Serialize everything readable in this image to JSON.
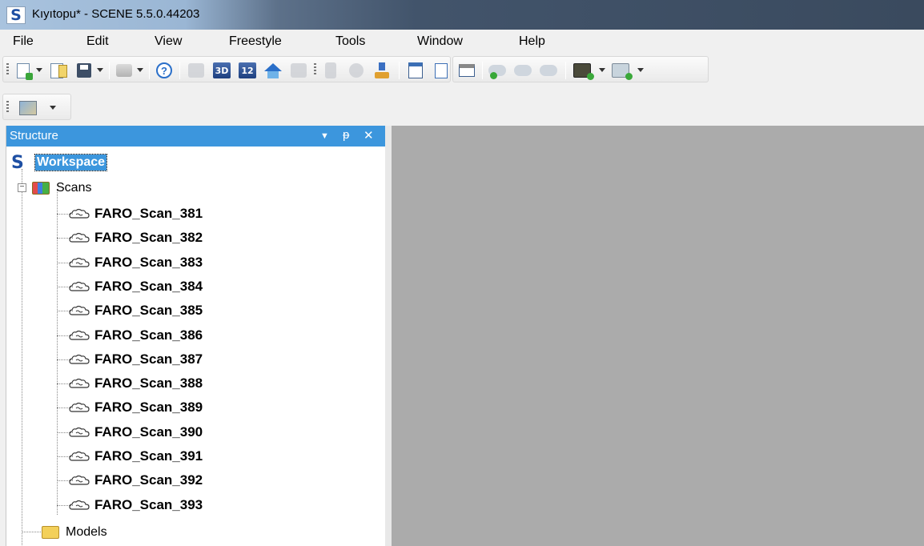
{
  "window": {
    "title": "Kıyıtopu* - SCENE 5.5.0.44203",
    "app_icon_glyph": "S"
  },
  "menu": [
    "File",
    "Edit",
    "View",
    "Freestyle",
    "Tools",
    "Window",
    "Help"
  ],
  "toolbar": {
    "icons": [
      "new-project-icon",
      "open-icon",
      "save-icon",
      "print-icon",
      "help-icon",
      "gray-tool-icon",
      "3d-view-icon",
      "quick-view-icon",
      "home-icon",
      "disabled-tool-icon",
      "disabled-page-icon",
      "disabled-search-icon",
      "import-icon",
      "calendar-icon",
      "report-icon",
      "list-icon",
      "cloud-add-icon",
      "cloud-icon",
      "cloud-remove-icon",
      "camera-add-icon",
      "camera-add-light-icon",
      "image-icon"
    ],
    "labels": {
      "view_3d": "3D",
      "quick_view": "12",
      "help": "?"
    }
  },
  "structure_panel": {
    "title": "Structure",
    "buttons": {
      "dropdown": "▼",
      "pin": "ᵽ",
      "close": "✕"
    },
    "workspace": {
      "icon_glyph": "S",
      "label": "Workspace"
    },
    "scans_folder": {
      "label": "Scans",
      "expander": "−"
    },
    "scans": [
      "FARO_Scan_381",
      "FARO_Scan_382",
      "FARO_Scan_383",
      "FARO_Scan_384",
      "FARO_Scan_385",
      "FARO_Scan_386",
      "FARO_Scan_387",
      "FARO_Scan_388",
      "FARO_Scan_389",
      "FARO_Scan_390",
      "FARO_Scan_391",
      "FARO_Scan_392",
      "FARO_Scan_393"
    ],
    "models_folder": {
      "label": "Models"
    }
  },
  "colors": {
    "accent": "#3c96dd",
    "view_background": "#ababab"
  }
}
